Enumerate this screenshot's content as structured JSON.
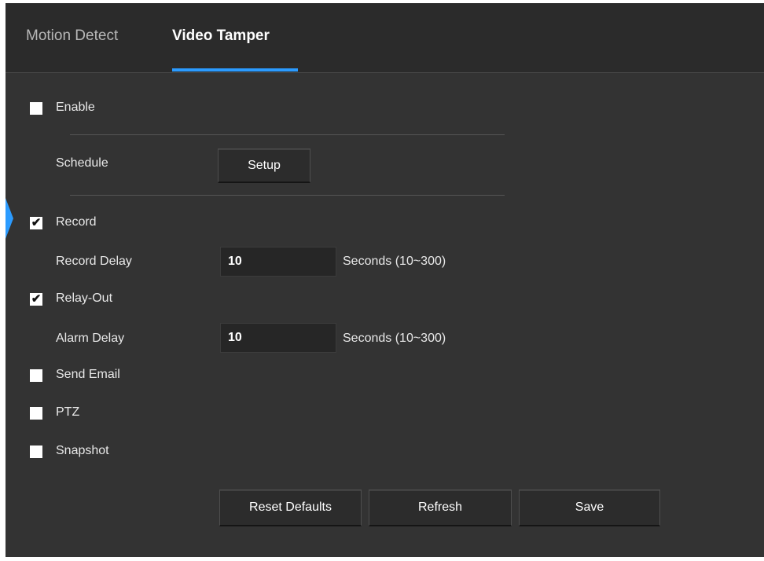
{
  "tabs": [
    {
      "label": "Motion Detect",
      "active": false
    },
    {
      "label": "Video Tamper",
      "active": true
    }
  ],
  "enable": {
    "label": "Enable",
    "checked": false
  },
  "schedule": {
    "label": "Schedule",
    "button": "Setup"
  },
  "record": {
    "label": "Record",
    "checked": true
  },
  "record_delay": {
    "label": "Record Delay",
    "value": "10",
    "unit": "Seconds (10~300)"
  },
  "relay_out": {
    "label": "Relay-Out",
    "checked": true
  },
  "alarm_delay": {
    "label": "Alarm Delay",
    "value": "10",
    "unit": "Seconds (10~300)"
  },
  "send_email": {
    "label": "Send Email",
    "checked": false
  },
  "ptz": {
    "label": "PTZ",
    "checked": false
  },
  "snapshot": {
    "label": "Snapshot",
    "checked": false
  },
  "buttons": {
    "reset": "Reset Defaults",
    "refresh": "Refresh",
    "save": "Save"
  },
  "colors": {
    "accent": "#2b9bff",
    "panel": "#333333",
    "tabbar": "#2b2b2b"
  },
  "icons": {
    "check": "✔"
  }
}
